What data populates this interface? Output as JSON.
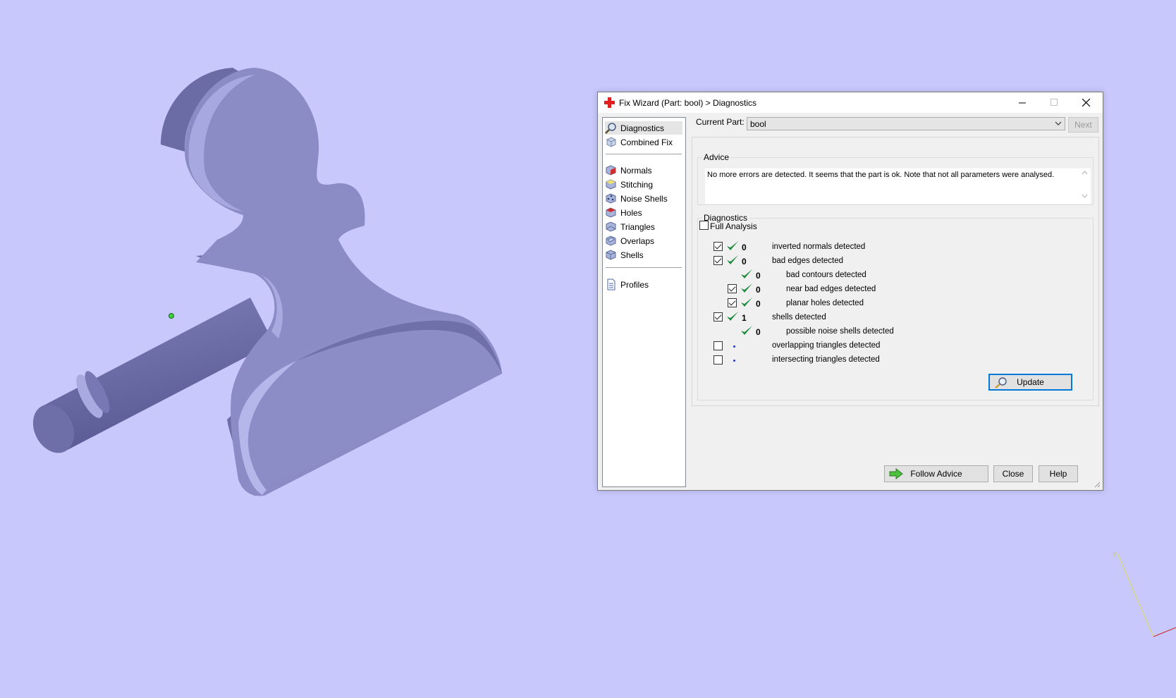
{
  "window": {
    "title": "Fix Wizard (Part: bool) > Diagnostics",
    "icon": "red-cross-icon",
    "min_icon": "minimize-icon",
    "max_icon": "maximize-icon",
    "close_icon": "close-icon"
  },
  "nav": {
    "items": [
      {
        "label": "Diagnostics",
        "icon": "magnifier-icon"
      },
      {
        "label": "Combined Fix",
        "icon": "cube-icon"
      },
      {
        "label": "Normals",
        "icon": "normals-cube-icon"
      },
      {
        "label": "Stitching",
        "icon": "stitching-cube-icon"
      },
      {
        "label": "Noise Shells",
        "icon": "noise-shells-icon"
      },
      {
        "label": "Holes",
        "icon": "holes-cube-icon"
      },
      {
        "label": "Triangles",
        "icon": "triangles-cube-icon"
      },
      {
        "label": "Overlaps",
        "icon": "overlaps-cube-icon"
      },
      {
        "label": "Shells",
        "icon": "shells-cube-icon"
      },
      {
        "label": "Profiles",
        "icon": "document-icon"
      }
    ]
  },
  "current_part": {
    "label": "Current Part:",
    "value": "bool",
    "next_label": "Next"
  },
  "advice": {
    "legend": "Advice",
    "text": "No more errors are detected. It seems that the part is ok. Note that not all parameters were analysed."
  },
  "diagnostics": {
    "legend": "Diagnostics",
    "full_analysis_label": "Full Analysis",
    "rows": [
      {
        "count": "0",
        "label": "inverted normals detected"
      },
      {
        "count": "0",
        "label": "bad edges detected"
      },
      {
        "count": "0",
        "label": "bad contours detected"
      },
      {
        "count": "0",
        "label": "near bad edges detected"
      },
      {
        "count": "0",
        "label": "planar holes detected"
      },
      {
        "count": "1",
        "label": "shells detected"
      },
      {
        "count": "0",
        "label": "possible noise shells detected"
      },
      {
        "count": "",
        "label": "overlapping triangles detected"
      },
      {
        "count": "",
        "label": "intersecting triangles detected"
      }
    ],
    "update_label": "Update"
  },
  "footer": {
    "follow_advice_label": "Follow Advice",
    "close_label": "Close",
    "help_label": "Help"
  },
  "colors": {
    "viewport_bg": "#c8c8fd",
    "model_face": "#8b8cc6",
    "check_green": "#1e8a3c"
  }
}
